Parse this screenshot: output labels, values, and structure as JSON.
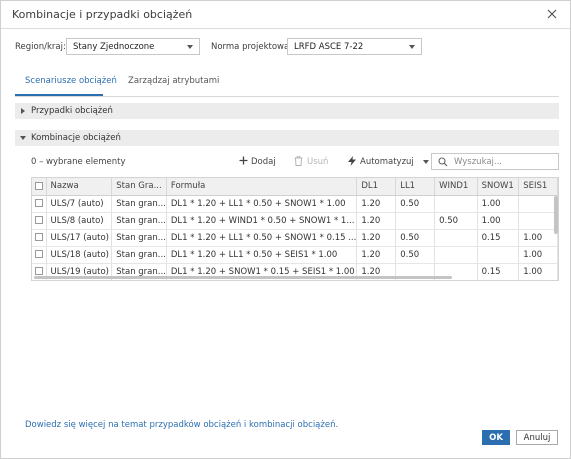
{
  "dialog": {
    "title": "Kombinacje i przypadki obciążeń"
  },
  "form": {
    "region_label": "Region/kraj:",
    "region_value": "Stany Zjednoczone",
    "code_label": "Norma projektowa:",
    "code_value": "LRFD ASCE 7-22"
  },
  "tabs": [
    {
      "label": "Scenariusze obciążeń",
      "active": true
    },
    {
      "label": "Zarządzaj atrybutami",
      "active": false
    }
  ],
  "sections": {
    "cases_label": "Przypadki obciążeń",
    "combos_label": "Kombinacje obciążeń"
  },
  "toolbar": {
    "selected_count": "0 – wybrane elementy",
    "add_label": "Dodaj",
    "remove_label": "Usuń",
    "automate_label": "Automatyzuj",
    "search_placeholder": "Wyszukaj..."
  },
  "table": {
    "columns": [
      "Nazwa",
      "Stan Gra...",
      "Formuła",
      "DL1",
      "LL1",
      "WIND1",
      "SNOW1",
      "SEIS1"
    ],
    "rows": [
      [
        "ULS/7 (auto)",
        "Stan gran...",
        "DL1 * 1.20 + LL1 * 0.50 + SNOW1 * 1.00",
        "1.20",
        "0.50",
        "",
        "1.00",
        ""
      ],
      [
        "ULS/8 (auto)",
        "Stan gran...",
        "DL1 * 1.20 + WIND1 * 0.50 + SNOW1 * 1...",
        "1.20",
        "",
        "0.50",
        "1.00",
        ""
      ],
      [
        "ULS/17 (auto)",
        "Stan gran...",
        "DL1 * 1.20 + LL1 * 0.50 + SNOW1 * 0.15 ...",
        "1.20",
        "0.50",
        "",
        "0.15",
        "1.00"
      ],
      [
        "ULS/18 (auto)",
        "Stan gran...",
        "DL1 * 1.20 + LL1 * 0.50 + SEIS1 * 1.00",
        "1.20",
        "0.50",
        "",
        "",
        "1.00"
      ],
      [
        "ULS/19 (auto)",
        "Stan gran...",
        "DL1 * 1.20 + SNOW1 * 0.15 + SEIS1 * 1.00",
        "1.20",
        "",
        "",
        "0.15",
        "1.00"
      ]
    ]
  },
  "footer": {
    "link_text": "Dowiedz się więcej na temat przypadków obciążeń i kombinacji obciążeń.",
    "ok_label": "OK",
    "cancel_label": "Anuluj"
  },
  "colors": {
    "accent": "#2c6fb1",
    "section_bg": "#ececec",
    "header_bg": "#f0f0f0"
  },
  "icons": [
    "close-icon",
    "chevron-down-icon",
    "triangle-right-icon",
    "triangle-down-icon",
    "plus-icon",
    "trash-icon",
    "lightning-icon",
    "search-icon",
    "checkbox-icon"
  ]
}
